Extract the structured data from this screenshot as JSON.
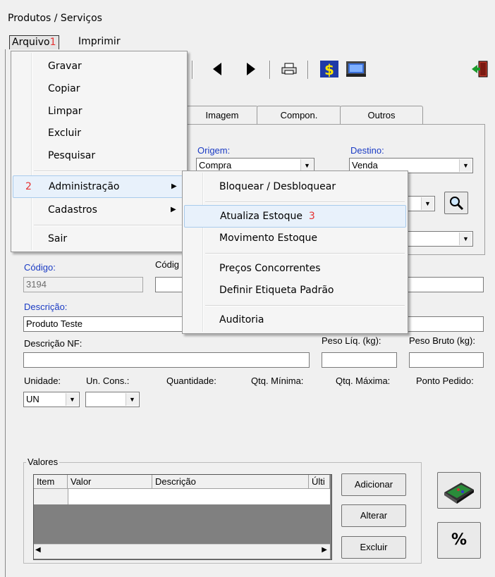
{
  "window": {
    "title": "Produtos / Serviços"
  },
  "menubar": {
    "arquivo": "Arquivo",
    "arquivo_mark": "1",
    "imprimir": "Imprimir"
  },
  "tabs": [
    "Imagem",
    "Compon.",
    "Outros"
  ],
  "fields": {
    "origem_label": "Origem:",
    "origem_value": "Compra",
    "destino_label": "Destino:",
    "destino_value": "Venda",
    "codigo_label": "Código:",
    "codigo_value": "3194",
    "codigo2_label": "Códig",
    "descricao_label": "Descrição:",
    "descricao_value": "Produto Teste",
    "descricao_nf_label": "Descrição NF:",
    "peso_liq_label": "Peso Líq. (kg):",
    "peso_bruto_label": "Peso Bruto (kg):",
    "unidade_label": "Unidade:",
    "unidade_value": "UN",
    "un_cons_label": "Un. Cons.:",
    "quantidade_label": "Quantidade:",
    "qtd_minima_label": "Qtq. Mínima:",
    "qtd_maxima_label": "Qtq. Máxima:",
    "ponto_pedido_label": "Ponto Pedido:"
  },
  "valores": {
    "group_label": "Valores",
    "columns": [
      "Item",
      "Valor",
      "Descrição",
      "Últi"
    ],
    "buttons": {
      "adicionar": "Adicionar",
      "alterar": "Alterar",
      "excluir": "Excluir"
    }
  },
  "file_menu": {
    "items": [
      "Gravar",
      "Copiar",
      "Limpar",
      "Excluir",
      "Pesquisar",
      "Administração",
      "Cadastros",
      "Sair"
    ],
    "admin_mark": "2"
  },
  "submenu": {
    "items": [
      "Bloquear / Desbloquear",
      "Atualiza Estoque",
      "Movimento Estoque",
      "Preços Concorrentes",
      "Definir Etiqueta Padrão",
      "Auditoria"
    ],
    "highlight_mark": "3"
  },
  "colors": {
    "accent_red": "#e53131",
    "label_blue": "#1a3bc4",
    "highlight": "#e8f1fb"
  }
}
